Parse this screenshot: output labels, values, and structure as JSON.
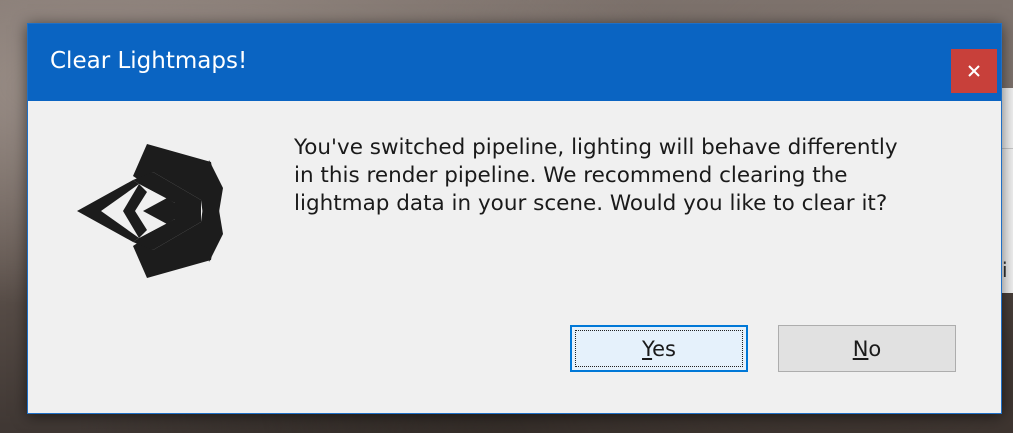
{
  "dialog": {
    "title": "Clear Lightmaps!",
    "close_icon": "close-x-icon",
    "logo_icon": "unity-logo-icon",
    "message_lines": [
      "You've switched pipeline, lighting will behave differently",
      "in this render pipeline. We recommend clearing the",
      "lightmap data in your scene. Would you like to clear it?"
    ],
    "buttons": {
      "yes": {
        "mnemonic": "Y",
        "rest": "es",
        "focused": true
      },
      "no": {
        "mnemonic": "N",
        "rest": "o",
        "focused": false
      }
    }
  },
  "colors": {
    "titlebar": "#0a64c2",
    "close_button": "#c8403a",
    "dialog_body": "#f0f0f0",
    "focused_button_border": "#0078d7"
  }
}
